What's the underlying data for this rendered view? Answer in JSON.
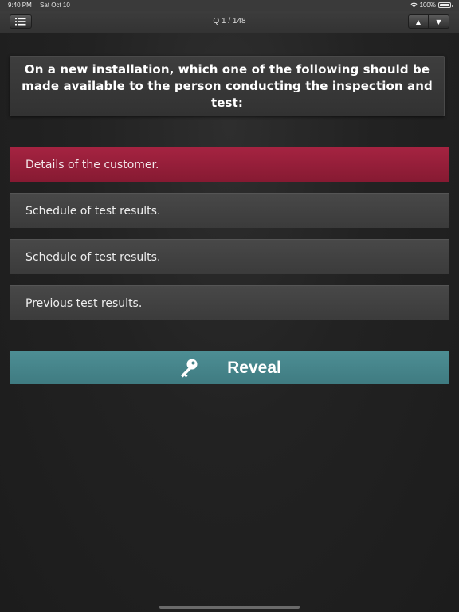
{
  "status_bar": {
    "time": "9:40 PM",
    "date": "Sat Oct 10",
    "battery_text": "100%",
    "battery_level": 1.0
  },
  "nav": {
    "menu_icon": "list-icon",
    "title": "Q 1 / 148",
    "up_glyph": "▲",
    "down_glyph": "▼"
  },
  "question": {
    "text": "On a new installation, which one of the following should be made available to the person conducting the inspection and test:"
  },
  "answers": [
    {
      "label": "Details of the customer.",
      "selected": true
    },
    {
      "label": "Schedule of test results.",
      "selected": false
    },
    {
      "label": "Schedule of test results.",
      "selected": false
    },
    {
      "label": "Previous test results.",
      "selected": false
    }
  ],
  "reveal": {
    "label": "Reveal",
    "icon": "key-icon"
  },
  "colors": {
    "selected_answer": "#9a1f3b",
    "answer_bg": "#424242",
    "reveal_bg": "#468489",
    "background": "#222222"
  }
}
